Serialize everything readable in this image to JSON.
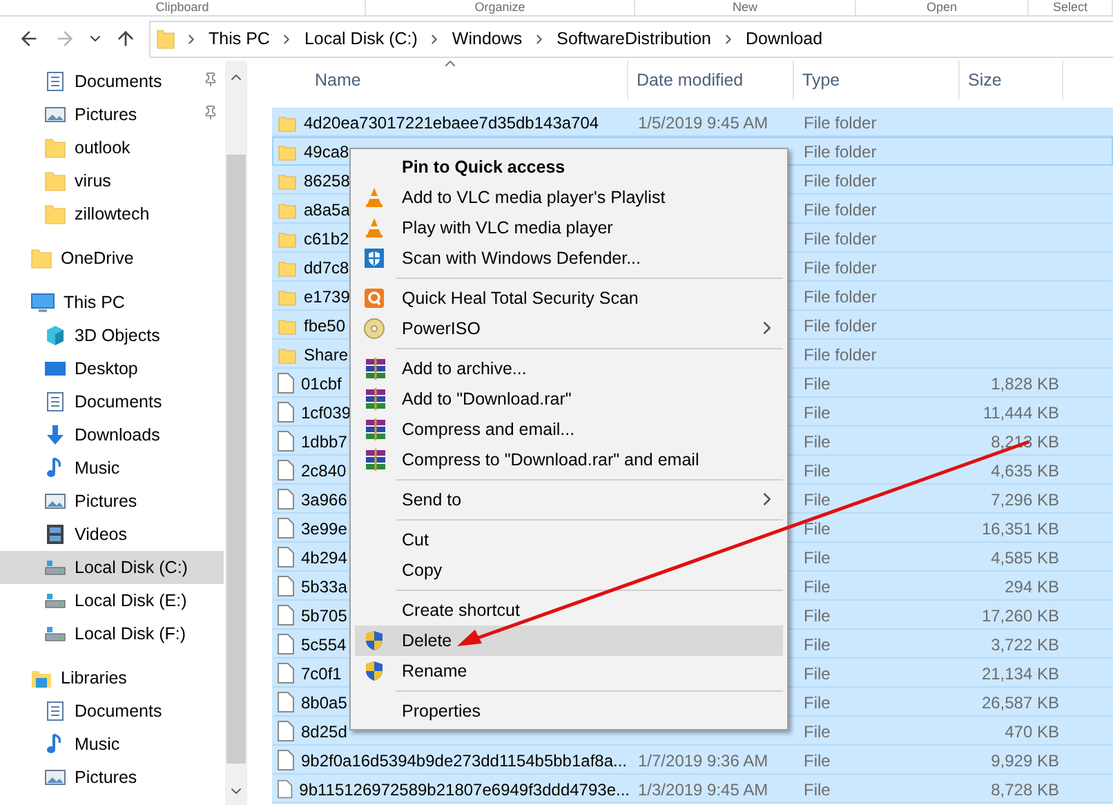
{
  "ribbon": [
    "Clipboard",
    "Organize",
    "New",
    "Open",
    "Select"
  ],
  "address": {
    "crumbs": [
      "This PC",
      "Local Disk (C:)",
      "Windows",
      "SoftwareDistribution",
      "Download"
    ]
  },
  "sidebar": {
    "items": [
      {
        "children": [
          {
            "label": "Documents",
            "kind": "documents",
            "pinned": true,
            "selected": false
          },
          {
            "label": "Pictures",
            "kind": "pictures",
            "pinned": true,
            "selected": false
          },
          {
            "label": "outlook",
            "kind": "folder",
            "pinned": false,
            "selected": false
          },
          {
            "label": "virus",
            "kind": "folder",
            "pinned": false,
            "selected": false
          },
          {
            "label": "zillowtech",
            "kind": "folder",
            "pinned": false,
            "selected": false
          }
        ]
      },
      {
        "label": "OneDrive",
        "kind": "folder",
        "selected": false
      },
      {
        "label": "This PC",
        "kind": "pc",
        "selected": false,
        "children": [
          {
            "label": "3D Objects",
            "kind": "cube",
            "selected": false
          },
          {
            "label": "Desktop",
            "kind": "desktop",
            "selected": false
          },
          {
            "label": "Documents",
            "kind": "documents",
            "selected": false
          },
          {
            "label": "Downloads",
            "kind": "downloads",
            "selected": false
          },
          {
            "label": "Music",
            "kind": "music",
            "selected": false
          },
          {
            "label": "Pictures",
            "kind": "pictures",
            "selected": false
          },
          {
            "label": "Videos",
            "kind": "videos",
            "selected": false
          },
          {
            "label": "Local Disk (C:)",
            "kind": "drive",
            "selected": true
          },
          {
            "label": "Local Disk (E:)",
            "kind": "drive",
            "selected": false
          },
          {
            "label": "Local Disk (F:)",
            "kind": "drive",
            "selected": false
          }
        ]
      },
      {
        "label": "Libraries",
        "kind": "libraries",
        "selected": false,
        "children": [
          {
            "label": "Documents",
            "kind": "documents",
            "selected": false
          },
          {
            "label": "Music",
            "kind": "music",
            "selected": false
          },
          {
            "label": "Pictures",
            "kind": "pictures",
            "selected": false
          }
        ]
      }
    ]
  },
  "columns": [
    {
      "label": "Name",
      "sorted": true
    },
    {
      "label": "Date modified",
      "sorted": false
    },
    {
      "label": "Type",
      "sorted": false
    },
    {
      "label": "Size",
      "sorted": false
    }
  ],
  "rows": [
    {
      "kind": "folder",
      "name": "4d20ea73017221ebaee7d35db143a704",
      "date": "1/5/2019 9:45 AM",
      "type": "File folder",
      "selected": true,
      "focused": false
    },
    {
      "kind": "folder",
      "name": "49ca8",
      "type": "File folder",
      "selected": true,
      "focused": true
    },
    {
      "kind": "folder",
      "name": "86258",
      "type": "File folder",
      "selected": true,
      "focused": false
    },
    {
      "kind": "folder",
      "name": "a8a5a",
      "type": "File folder",
      "selected": true,
      "focused": false
    },
    {
      "kind": "folder",
      "name": "c61b2",
      "type": "File folder",
      "selected": true,
      "focused": false
    },
    {
      "kind": "folder",
      "name": "dd7c8",
      "type": "File folder",
      "selected": true,
      "focused": false
    },
    {
      "kind": "folder",
      "name": "e1739",
      "type": "File folder",
      "selected": true,
      "focused": false
    },
    {
      "kind": "folder",
      "name": "fbe50",
      "type": "File folder",
      "selected": true,
      "focused": false
    },
    {
      "kind": "folder",
      "name": "Share",
      "type": "File folder",
      "selected": true,
      "focused": false
    },
    {
      "kind": "file",
      "name": "01cbf",
      "type": "File",
      "size": "1,828 KB",
      "selected": true,
      "focused": false
    },
    {
      "kind": "file",
      "name": "1cf039",
      "type": "File",
      "size": "11,444 KB",
      "selected": true,
      "focused": false
    },
    {
      "kind": "file",
      "name": "1dbb7",
      "type": "File",
      "size": "8,213 KB",
      "selected": true,
      "focused": false
    },
    {
      "kind": "file",
      "name": "2c840",
      "type": "File",
      "size": "4,635 KB",
      "selected": true,
      "focused": false
    },
    {
      "kind": "file",
      "name": "3a966",
      "type": "File",
      "size": "7,296 KB",
      "selected": true,
      "focused": false
    },
    {
      "kind": "file",
      "name": "3e99e",
      "type": "File",
      "size": "16,351 KB",
      "selected": true,
      "focused": false
    },
    {
      "kind": "file",
      "name": "4b294",
      "type": "File",
      "size": "4,585 KB",
      "selected": true,
      "focused": false
    },
    {
      "kind": "file",
      "name": "5b33a",
      "type": "File",
      "size": "294 KB",
      "selected": true,
      "focused": false
    },
    {
      "kind": "file",
      "name": "5b705",
      "type": "File",
      "size": "17,260 KB",
      "selected": true,
      "focused": false
    },
    {
      "kind": "file",
      "name": "5c554",
      "type": "File",
      "size": "3,722 KB",
      "selected": true,
      "focused": false
    },
    {
      "kind": "file",
      "name": "7c0f1",
      "type": "File",
      "size": "21,134 KB",
      "selected": true,
      "focused": false
    },
    {
      "kind": "file",
      "name": "8b0a5",
      "type": "File",
      "size": "26,587 KB",
      "selected": true,
      "focused": false
    },
    {
      "kind": "file",
      "name": "8d25d",
      "type": "File",
      "size": "470 KB",
      "selected": true,
      "focused": false
    },
    {
      "kind": "file",
      "name": "9b2f0a16d5394b9de273dd1154b5bb1af8a...",
      "date": "1/7/2019 9:36 AM",
      "type": "File",
      "size": "9,929 KB",
      "selected": true,
      "focused": false
    },
    {
      "kind": "file",
      "name": "9b115126972589b21807e6949f3ddd4793e...",
      "date": "1/3/2019 9:45 AM",
      "type": "File",
      "size": "8,728 KB",
      "selected": true,
      "focused": false
    }
  ],
  "context_menu": {
    "items": [
      {
        "kind": "plain",
        "label": "Pin to Quick access",
        "bold": true,
        "submenu": false,
        "selected": false
      },
      {
        "kind": "cone",
        "label": "Add to VLC media player's Playlist",
        "bold": false,
        "submenu": false,
        "selected": false
      },
      {
        "kind": "cone",
        "label": "Play with VLC media player",
        "bold": false,
        "submenu": false,
        "selected": false
      },
      {
        "kind": "defender",
        "label": "Scan with Windows Defender...",
        "bold": false,
        "submenu": false,
        "selected": false
      },
      {
        "kind": "separator"
      },
      {
        "kind": "quickheal",
        "label": "Quick Heal Total Security Scan",
        "bold": false,
        "submenu": false,
        "selected": false
      },
      {
        "kind": "disc",
        "label": "PowerISO",
        "bold": false,
        "submenu": true,
        "selected": false
      },
      {
        "kind": "separator"
      },
      {
        "kind": "books",
        "label": "Add to archive...",
        "bold": false,
        "submenu": false,
        "selected": false
      },
      {
        "kind": "books",
        "label": "Add to \"Download.rar\"",
        "bold": false,
        "submenu": false,
        "selected": false
      },
      {
        "kind": "books",
        "label": "Compress and email...",
        "bold": false,
        "submenu": false,
        "selected": false
      },
      {
        "kind": "books",
        "label": "Compress to \"Download.rar\" and email",
        "bold": false,
        "submenu": false,
        "selected": false
      },
      {
        "kind": "separator"
      },
      {
        "kind": "plain",
        "label": "Send to",
        "bold": false,
        "submenu": true,
        "selected": false
      },
      {
        "kind": "separator"
      },
      {
        "kind": "plain",
        "label": "Cut",
        "bold": false,
        "submenu": false,
        "selected": false
      },
      {
        "kind": "plain",
        "label": "Copy",
        "bold": false,
        "submenu": false,
        "selected": false
      },
      {
        "kind": "separator"
      },
      {
        "kind": "plain",
        "label": "Create shortcut",
        "bold": false,
        "submenu": false,
        "selected": false
      },
      {
        "kind": "shield",
        "label": "Delete",
        "bold": false,
        "submenu": false,
        "selected": true
      },
      {
        "kind": "shield",
        "label": "Rename",
        "bold": false,
        "submenu": false,
        "selected": false
      },
      {
        "kind": "separator"
      },
      {
        "kind": "plain",
        "label": "Properties",
        "bold": false,
        "submenu": false,
        "selected": false
      }
    ]
  }
}
